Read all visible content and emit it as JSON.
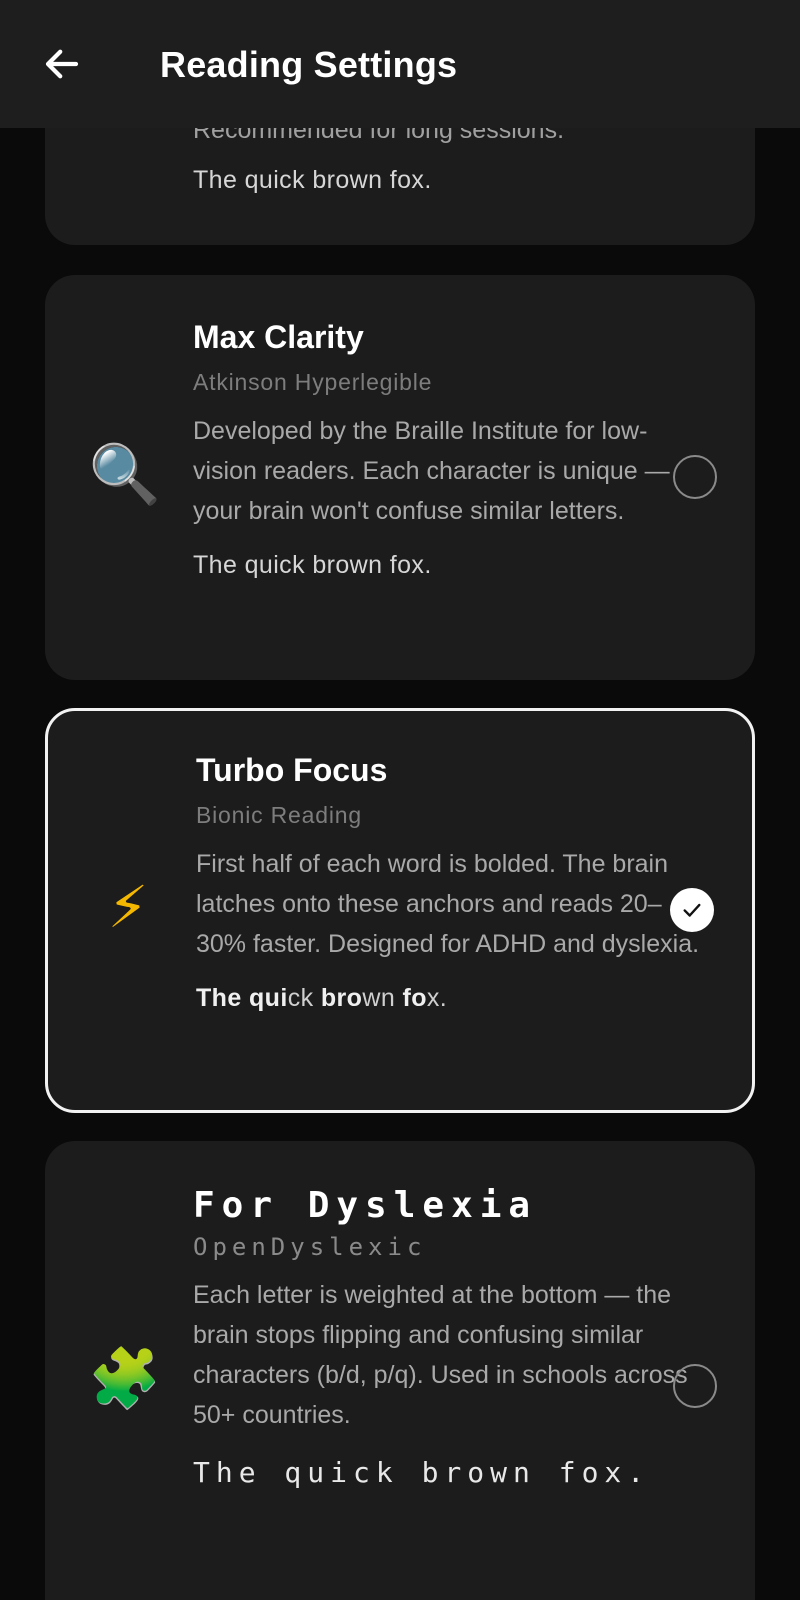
{
  "header": {
    "title": "Reading Settings",
    "back_icon": "arrow-left-icon"
  },
  "cards": [
    {
      "id": "recommended",
      "partial_desc": "Recommended for long sessions.",
      "sample": "The quick brown fox."
    },
    {
      "id": "max-clarity",
      "icon": "magnifier-icon",
      "icon_glyph": "🔍",
      "title": "Max Clarity",
      "font": "Atkinson Hyperlegible",
      "desc": "Developed by the Braille Institute for low-vision readers. Each character is unique — your brain won't confuse similar letters.",
      "sample": "The quick brown fox.",
      "selected": false
    },
    {
      "id": "turbo-focus",
      "icon": "lightning-icon",
      "icon_glyph": "⚡",
      "title": "Turbo Focus",
      "font": "Bionic Reading",
      "desc": "First half of each word is bolded. The brain latches onto these anchors and reads 20–30% faster. Designed for ADHD and dyslexia.",
      "sample_parts": [
        {
          "b": "The",
          "r": " "
        },
        {
          "b": "qui",
          "r": "ck "
        },
        {
          "b": "bro",
          "r": "wn "
        },
        {
          "b": "fo",
          "r": "x."
        }
      ],
      "selected": true
    },
    {
      "id": "for-dyslexia",
      "icon": "puzzle-icon",
      "icon_glyph": "🧩",
      "title": "For Dyslexia",
      "font": "OpenDyslexic",
      "desc": "Each letter is weighted at the bottom — the brain stops flipping and confusing similar characters (b/d, p/q). Used in schools across 50+ countries.",
      "sample": "The quick brown fox.",
      "selected": false
    }
  ],
  "colors": {
    "background": "#0a0a0a",
    "header": "#1e1e1e",
    "card": "#1c1c1c",
    "selected_border": "#f2f2f2",
    "muted_text": "#a9a9a9"
  }
}
